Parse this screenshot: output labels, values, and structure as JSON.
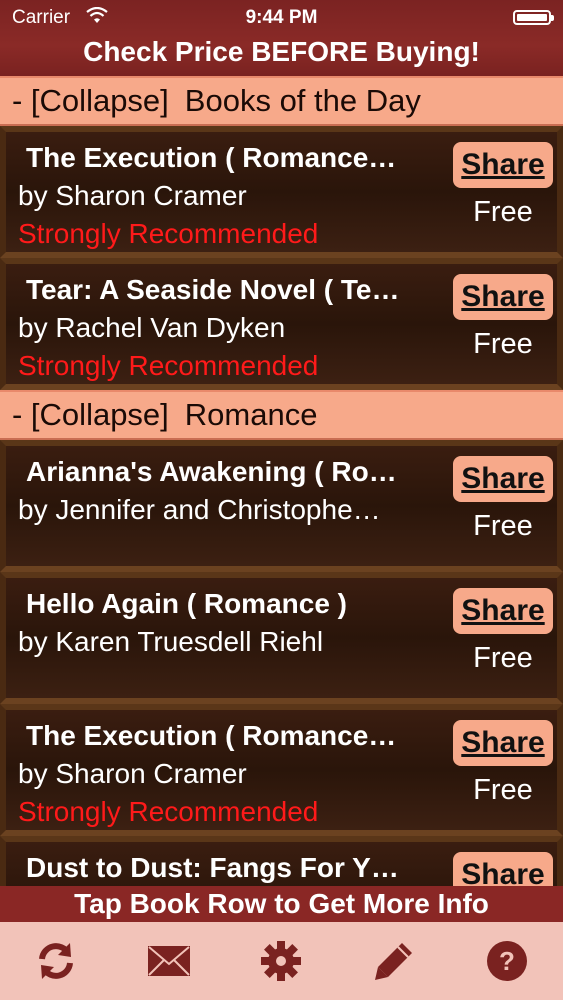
{
  "status": {
    "carrier": "Carrier",
    "time": "9:44 PM"
  },
  "header": {
    "title": "Check Price BEFORE Buying!"
  },
  "sections": [
    {
      "toggle": "- [Collapse]",
      "name": "Books of the Day",
      "rows": [
        {
          "title": "The Execution ( Romance…",
          "author": "by Sharon Cramer",
          "recommendation": "Strongly Recommended",
          "share": "Share",
          "price": "Free"
        },
        {
          "title": "Tear: A Seaside Novel ( Te…",
          "author": "by Rachel Van Dyken",
          "recommendation": "Strongly Recommended",
          "share": "Share",
          "price": "Free"
        }
      ]
    },
    {
      "toggle": "- [Collapse]",
      "name": "Romance",
      "rows": [
        {
          "title": "Arianna's Awakening ( Ro…",
          "author": "by Jennifer and Christophe…",
          "recommendation": "",
          "share": "Share",
          "price": "Free"
        },
        {
          "title": "Hello Again ( Romance )",
          "author": "by Karen Truesdell Riehl",
          "recommendation": "",
          "share": "Share",
          "price": "Free"
        },
        {
          "title": "The Execution ( Romance…",
          "author": "by Sharon Cramer",
          "recommendation": "Strongly Recommended",
          "share": "Share",
          "price": "Free"
        },
        {
          "title": "Dust to Dust: Fangs For Y…",
          "author": "",
          "recommendation": "",
          "share": "Share",
          "price": ""
        }
      ]
    }
  ],
  "footer": {
    "label": "Tap Book Row to Get More Info"
  },
  "tabbar": {
    "icons": [
      "refresh-icon",
      "mail-icon",
      "gear-icon",
      "pencil-icon",
      "help-icon"
    ],
    "color": "#7a2220"
  },
  "colors": {
    "accent": "#f7a98a",
    "recommended": "#ff1a1a",
    "header": "#8a2725"
  }
}
